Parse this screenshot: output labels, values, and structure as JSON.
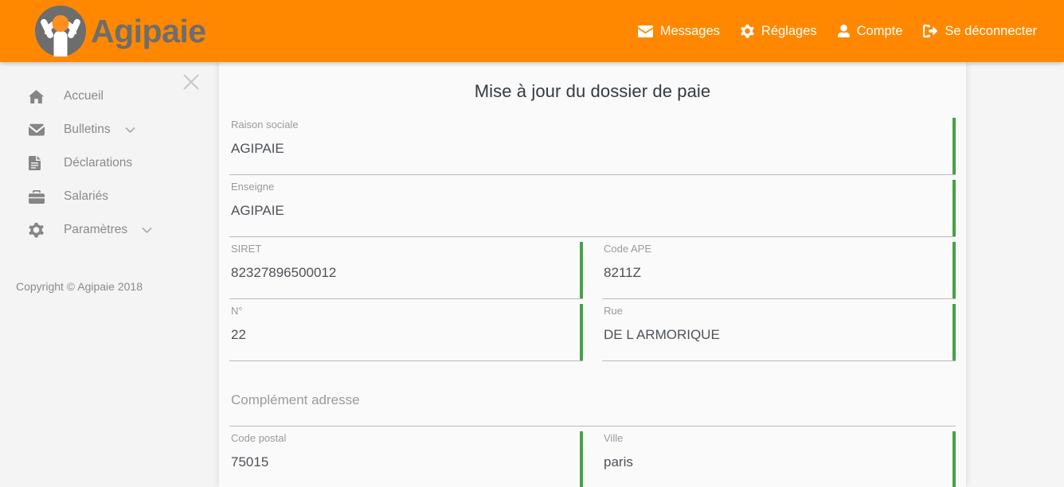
{
  "header": {
    "brand_name": "Agipaie",
    "nav": [
      {
        "label": "Messages",
        "icon": "envelope-icon"
      },
      {
        "label": "Réglages",
        "icon": "gear-icon"
      },
      {
        "label": "Compte",
        "icon": "user-icon"
      },
      {
        "label": "Se déconnecter",
        "icon": "logout-icon"
      }
    ]
  },
  "sidebar": {
    "close_icon": "close-icon",
    "items": [
      {
        "label": "Accueil",
        "icon": "home-icon",
        "caret": false
      },
      {
        "label": "Bulletins",
        "icon": "envelope-icon",
        "caret": true
      },
      {
        "label": "Déclarations",
        "icon": "document-icon",
        "caret": false
      },
      {
        "label": "Salariés",
        "icon": "briefcase-icon",
        "caret": false
      },
      {
        "label": "Paramètres",
        "icon": "gear-icon",
        "caret": true
      }
    ],
    "copyright": "Copyright © Agipaie 2018"
  },
  "main": {
    "title": "Mise à jour du dossier de paie",
    "fields": {
      "raison_sociale": {
        "label": "Raison sociale",
        "value": "AGIPAIE"
      },
      "enseigne": {
        "label": "Enseigne",
        "value": "AGIPAIE"
      },
      "siret": {
        "label": "SIRET",
        "value": "82327896500012"
      },
      "code_ape": {
        "label": "Code APE",
        "value": "8211Z"
      },
      "numero": {
        "label": "N°",
        "value": "22"
      },
      "rue": {
        "label": "Rue",
        "value": "DE L ARMORIQUE"
      },
      "complement": {
        "label": "",
        "value": "Complément adresse"
      },
      "code_postal": {
        "label": "Code postal",
        "value": "75015"
      },
      "ville": {
        "label": "Ville",
        "value": "paris"
      }
    }
  },
  "colors": {
    "brand_orange": "#ff8800",
    "valid_green": "#45a247",
    "logo_grey": "#6d6d6d"
  }
}
